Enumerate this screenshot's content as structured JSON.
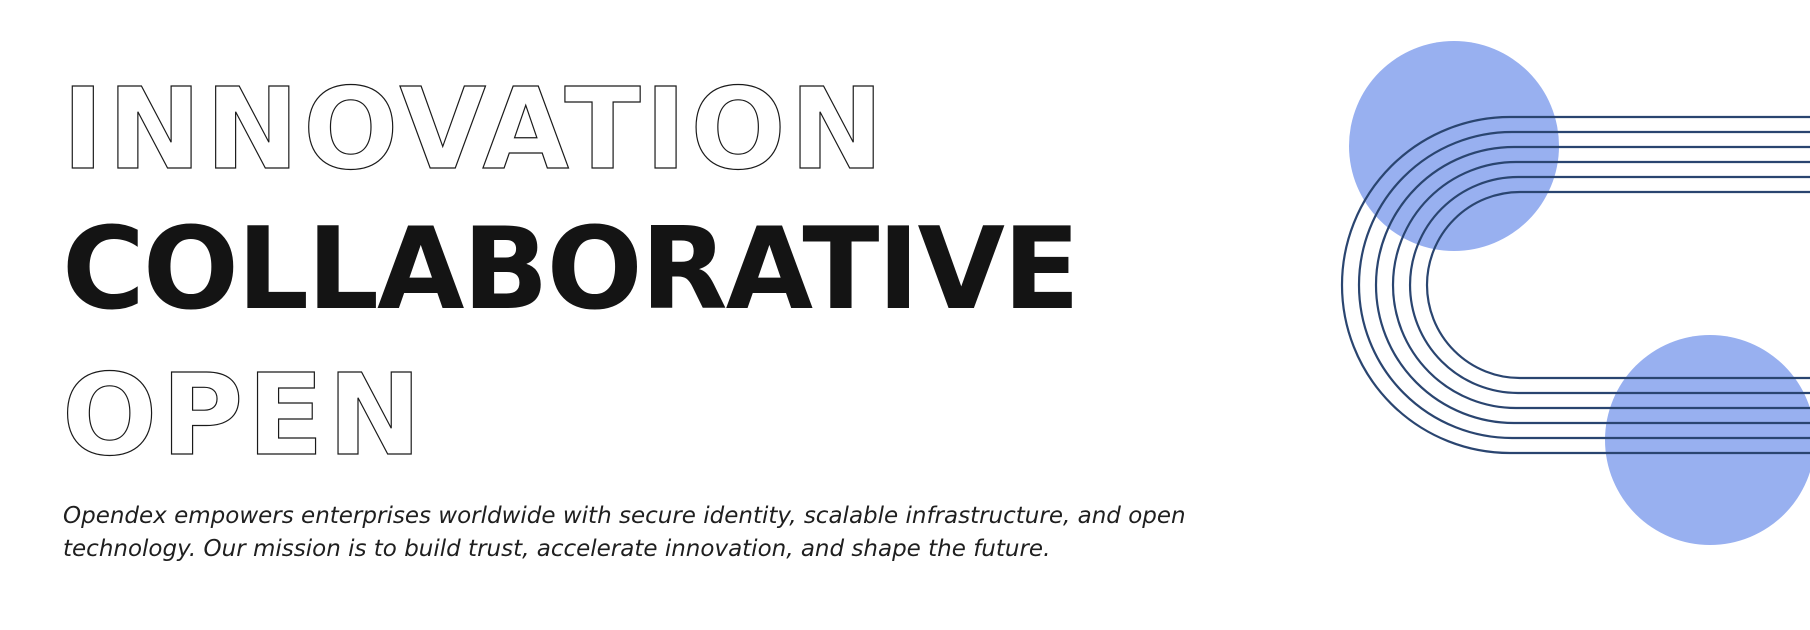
{
  "headline": {
    "line1": "INNOVATION",
    "line2": "COLLABORATIVE",
    "line3": "OPEN"
  },
  "mission": "Opendex empowers enterprises worldwide with secure identity, scalable infrastructure, and open technology. Our mission is to build trust, accelerate innovation, and shape the future.",
  "colors": {
    "accent_circle": "#98b0f0",
    "line_stroke": "#2a4570",
    "text_dark": "#141414"
  }
}
